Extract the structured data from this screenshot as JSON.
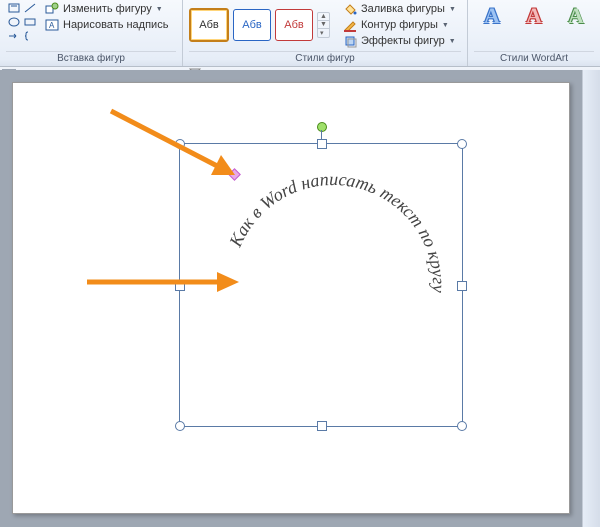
{
  "ribbon": {
    "group_insert_shapes": "Вставка фигур",
    "group_shape_styles": "Стили фигур",
    "group_wordart_styles": "Стили WordArt",
    "edit_shape": "Изменить фигуру",
    "draw_textbox": "Нарисовать надпись",
    "style_preview": "Абв",
    "shape_fill": "Заливка фигуры",
    "shape_outline": "Контур фигуры",
    "shape_effects": "Эффекты фигур",
    "wordart_letter": "A"
  },
  "document": {
    "circular_text": "Как в Word написать текст по кругу"
  }
}
